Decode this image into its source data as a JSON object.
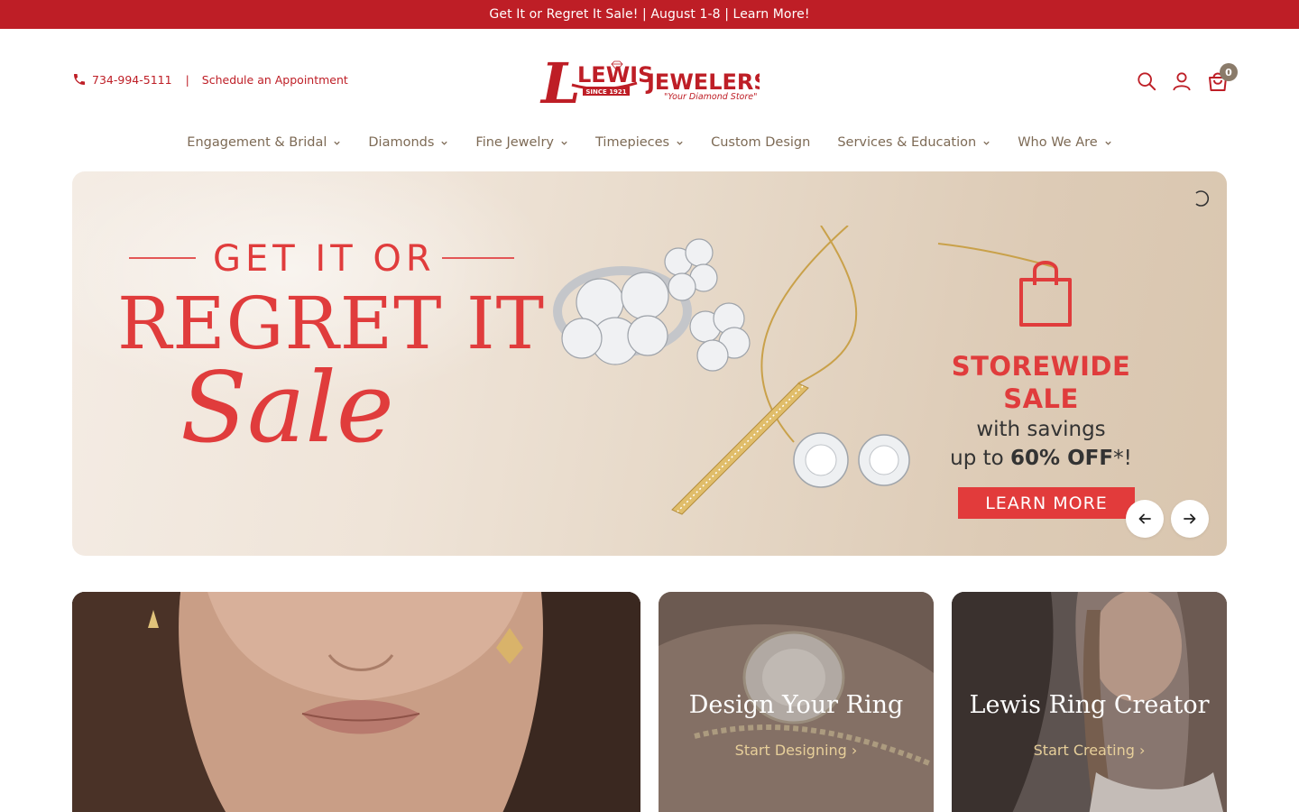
{
  "announcement": {
    "text": "Get It or Regret It Sale! | August 1-8 | Learn More!"
  },
  "header": {
    "phone": "734-994-5111",
    "separator": "|",
    "appointment": "Schedule an Appointment",
    "logo": {
      "brand_main": "LEWIS",
      "brand_second": "JEWELERS",
      "since": "SINCE 1921",
      "tagline": "\"Your Diamond Store\""
    },
    "cart_count": "0"
  },
  "nav": {
    "items": [
      {
        "label": "Engagement & Bridal",
        "dropdown": true
      },
      {
        "label": "Diamonds",
        "dropdown": true
      },
      {
        "label": "Fine Jewelry",
        "dropdown": true
      },
      {
        "label": "Timepieces",
        "dropdown": true
      },
      {
        "label": "Custom Design",
        "dropdown": false
      },
      {
        "label": "Services & Education",
        "dropdown": true
      },
      {
        "label": "Who We Are",
        "dropdown": true
      }
    ]
  },
  "hero": {
    "line1": "GET IT OR",
    "line2": "REGRET IT",
    "line3": "Sale",
    "storewide": "STOREWIDE SALE",
    "savings_line1": "with savings",
    "savings_prefix": "up to ",
    "savings_bold": "60% OFF",
    "savings_suffix": "*!",
    "cta": "LEARN MORE"
  },
  "tiles": [
    {
      "title": "Design Your Ring",
      "link": "Start Designing ›"
    },
    {
      "title": "Lewis Ring Creator",
      "link": "Start Creating ›"
    }
  ],
  "colors": {
    "brand_red": "#be1e26",
    "nav_text": "#7d6a55",
    "hero_red": "#e03c3c",
    "tile_link": "#e7cf9a"
  }
}
